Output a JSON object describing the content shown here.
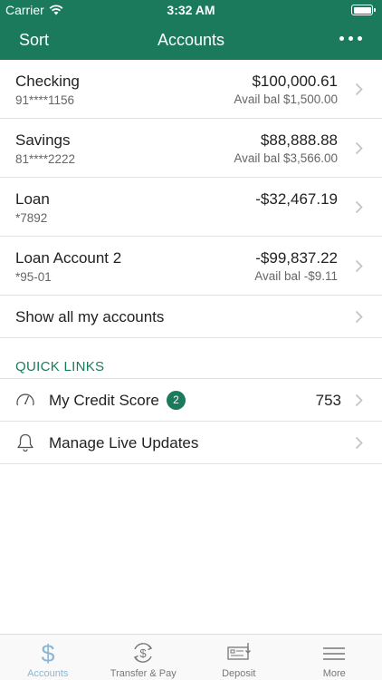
{
  "status": {
    "carrier": "Carrier",
    "time": "3:32 AM"
  },
  "nav": {
    "left": "Sort",
    "title": "Accounts"
  },
  "accounts": [
    {
      "name": "Checking",
      "number": "91****1156",
      "balance": "$100,000.61",
      "available": "Avail bal $1,500.00"
    },
    {
      "name": "Savings",
      "number": "81****2222",
      "balance": "$88,888.88",
      "available": "Avail bal $3,566.00"
    },
    {
      "name": "Loan",
      "number": "*7892",
      "balance": "-$32,467.19",
      "available": ""
    },
    {
      "name": "Loan Account 2",
      "number": "*95-01",
      "balance": "-$99,837.22",
      "available": "Avail bal -$9.11"
    }
  ],
  "show_all": "Show all my accounts",
  "quick_links": {
    "header": "QUICK LINKS",
    "items": [
      {
        "label": "My Credit Score",
        "badge": "2",
        "value": "753",
        "icon": "gauge-icon"
      },
      {
        "label": "Manage Live Updates",
        "icon": "bell-icon"
      }
    ]
  },
  "tabs": [
    {
      "label": "Accounts",
      "icon": "dollar-icon",
      "active": true
    },
    {
      "label": "Transfer & Pay",
      "icon": "transfer-icon"
    },
    {
      "label": "Deposit",
      "icon": "check-deposit-icon"
    },
    {
      "label": "More",
      "icon": "menu-icon"
    }
  ],
  "colors": {
    "brand": "#1c7a5c",
    "active_tab": "#8ab7d9"
  }
}
